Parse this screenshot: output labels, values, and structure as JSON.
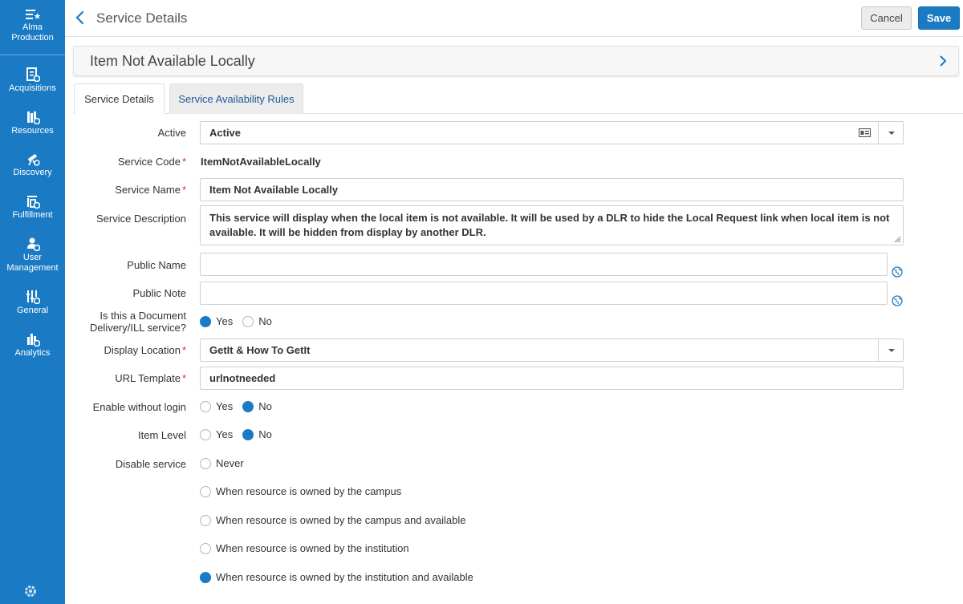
{
  "sidebar": {
    "top": {
      "label_line1": "Alma",
      "label_line2": "Production"
    },
    "items": [
      {
        "label": "Acquisitions",
        "icon": "acquisitions-icon"
      },
      {
        "label": "Resources",
        "icon": "resources-icon"
      },
      {
        "label": "Discovery",
        "icon": "discovery-icon"
      },
      {
        "label": "Fulfillment",
        "icon": "fulfillment-icon"
      },
      {
        "label_line1": "User",
        "label_line2": "Management",
        "icon": "user-management-icon"
      },
      {
        "label": "General",
        "icon": "general-icon"
      },
      {
        "label": "Analytics",
        "icon": "analytics-icon"
      }
    ]
  },
  "header": {
    "title": "Service Details",
    "cancel_label": "Cancel",
    "save_label": "Save"
  },
  "banner": {
    "title": "Item Not Available Locally"
  },
  "tabs": [
    {
      "label": "Service Details",
      "active": true
    },
    {
      "label": "Service Availability Rules",
      "active": false
    }
  ],
  "form": {
    "active": {
      "label": "Active",
      "value": "Active"
    },
    "service_code": {
      "label": "Service Code",
      "value": "ItemNotAvailableLocally"
    },
    "service_name": {
      "label": "Service Name",
      "value": "Item Not Available Locally"
    },
    "service_description": {
      "label": "Service Description",
      "value": "This service will display when the local item is not available. It will be used by a DLR to hide the Local Request link when local item is not available. It will be hidden from display by another DLR."
    },
    "public_name": {
      "label": "Public Name",
      "value": ""
    },
    "public_note": {
      "label": "Public Note",
      "value": ""
    },
    "doc_delivery": {
      "label_line1": "Is this a Document",
      "label_line2": "Delivery/ILL service?",
      "options": [
        "Yes",
        "No"
      ],
      "selected": "Yes"
    },
    "display_location": {
      "label": "Display Location",
      "value": "GetIt & How To GetIt"
    },
    "url_template": {
      "label": "URL Template",
      "value": "urlnotneeded"
    },
    "enable_without_login": {
      "label": "Enable without login",
      "options": [
        "Yes",
        "No"
      ],
      "selected": "No"
    },
    "item_level": {
      "label": "Item Level",
      "options": [
        "Yes",
        "No"
      ],
      "selected": "No"
    },
    "disable_service": {
      "label": "Disable service",
      "options": [
        "Never",
        "When resource is owned by the campus",
        "When resource is owned by the campus and available",
        "When resource is owned by the institution",
        "When resource is owned by the institution and available"
      ],
      "selected": "When resource is owned by the institution and available"
    }
  },
  "colors": {
    "accent": "#1a7bc4",
    "required": "#d32f2f",
    "tab_link": "#1f5a99"
  }
}
